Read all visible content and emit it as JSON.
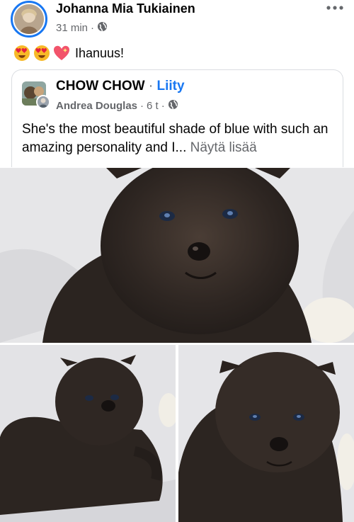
{
  "post": {
    "author": "Johanna Mia Tukiainen",
    "time": "31 min",
    "separator": "·",
    "privacy_icon": "globe-icon",
    "more_icon": "more-options-icon",
    "caption": "Ihanuus!",
    "emojis": [
      "heart-eyes-emoji",
      "heart-eyes-emoji",
      "sparkling-heart-emoji"
    ]
  },
  "shared": {
    "group_name": "CHOW CHOW",
    "separator": "·",
    "join_label": "Liity",
    "author": "Andrea Douglas",
    "time": "6 t",
    "body": "She's the most beautiful shade of blue with such an amazing personality and I...",
    "see_more": "Näytä lisää"
  },
  "colors": {
    "link_blue": "#1877f2",
    "meta_gray": "#65676b",
    "text": "#050505"
  }
}
